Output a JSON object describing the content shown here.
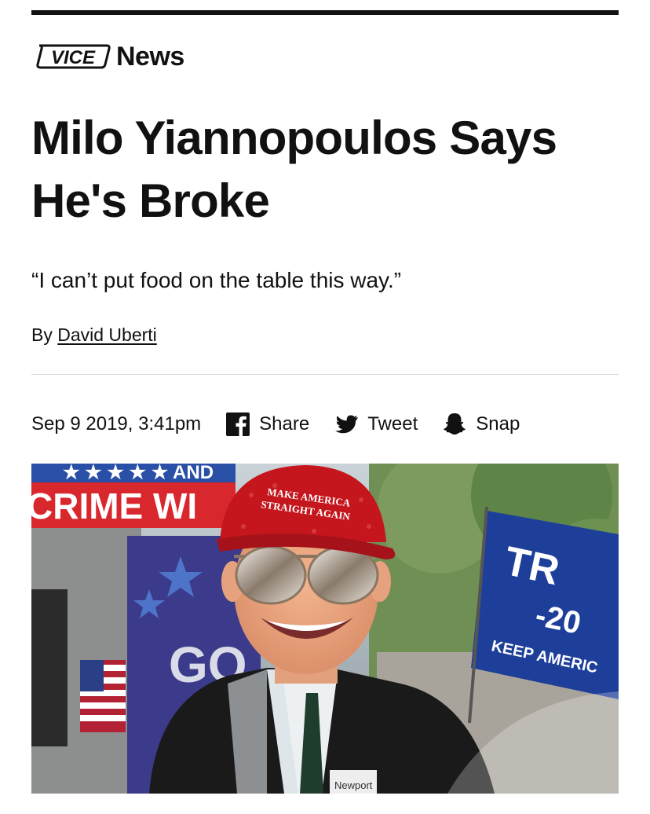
{
  "brand": {
    "logo_text": "VICE",
    "section": "News",
    "logo_alt": "vice-logo"
  },
  "article": {
    "headline": "Milo Yiannopoulos Says He's Broke",
    "dek": "“I can’t put food on the table this way.”",
    "byline_prefix": "By",
    "author": "David Uberti",
    "timestamp": "Sep 9 2019, 3:41pm"
  },
  "share": [
    {
      "label": "Share",
      "icon": "facebook-icon"
    },
    {
      "label": "Tweet",
      "icon": "twitter-icon"
    },
    {
      "label": "Snap",
      "icon": "snapchat-icon"
    }
  ],
  "hero_image": {
    "banner_top": "★ ★ ★ ★ ★  AND",
    "banner_main": "CRIME WI",
    "cap_line1": "MAKE AMERICA",
    "cap_line2": "STRAIGHT AGAIN",
    "flag_line1": "TR",
    "flag_line2": "-20",
    "flag_line3": "KEEP AMERIC",
    "sign_text": "GO",
    "badge_text": "Newport"
  },
  "colors": {
    "text": "#111111",
    "divider": "#d6d6d6",
    "cap_red": "#c4161c",
    "flag_blue": "#1d3f99"
  }
}
